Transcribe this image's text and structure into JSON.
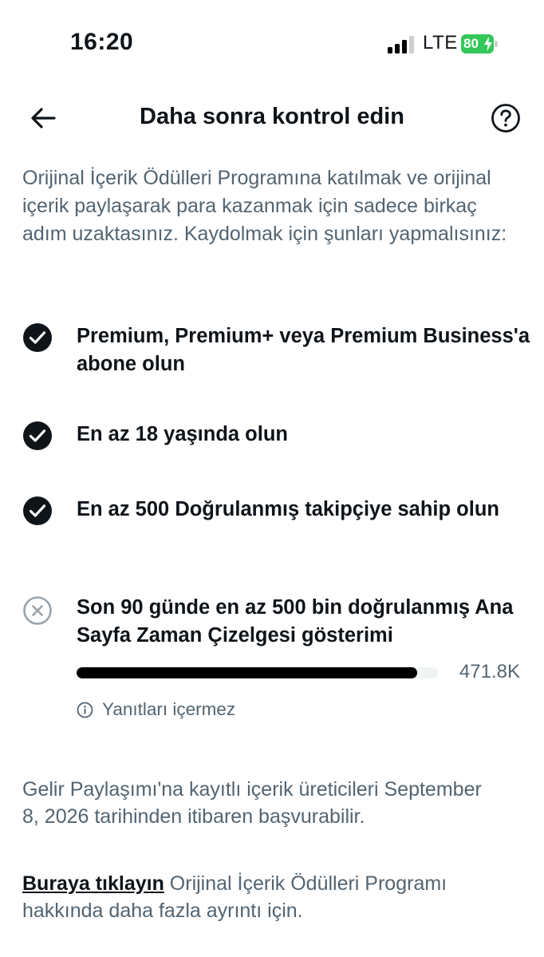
{
  "status_bar": {
    "time": "16:20",
    "network": "LTE",
    "battery": "80",
    "battery_color": "#34c759"
  },
  "header": {
    "title": "Daha sonra kontrol edin",
    "back_icon": "arrow-left-icon",
    "help_icon": "question-circle-icon"
  },
  "intro": "Orijinal İçerik Ödülleri Programına katılmak ve orijinal içerik paylaşarak para kazanmak için sadece birkaç adım uzaktasınız. Kaydolmak için şunları yapmalısınız:",
  "requirements": [
    {
      "text": "Premium, Premium+ veya Premium Business'a abone olun",
      "status": "done"
    },
    {
      "text": "En az 18 yaşında olun",
      "status": "done"
    },
    {
      "text": "En az 500 Doğrulanmış takipçiye sahip olun",
      "status": "done"
    },
    {
      "text": "Son 90 günde en az 500 bin doğrulanmış Ana Sayfa Zaman Çizelgesi gösterimi",
      "status": "not_met"
    }
  ],
  "progress": {
    "value_label": "471.8K",
    "fraction": 0.9436
  },
  "note": "Yanıtları içermez",
  "footer": {
    "eligibility": "Gelir Paylaşımı'na kayıtlı içerik üreticileri September 8, 2026 tarihinden itibaren başvurabilir.",
    "link_text": "Buraya tıklayın",
    "link_suffix": " Orijinal İçerik Ödülleri Programı hakkında daha fazla ayrıntı için."
  }
}
